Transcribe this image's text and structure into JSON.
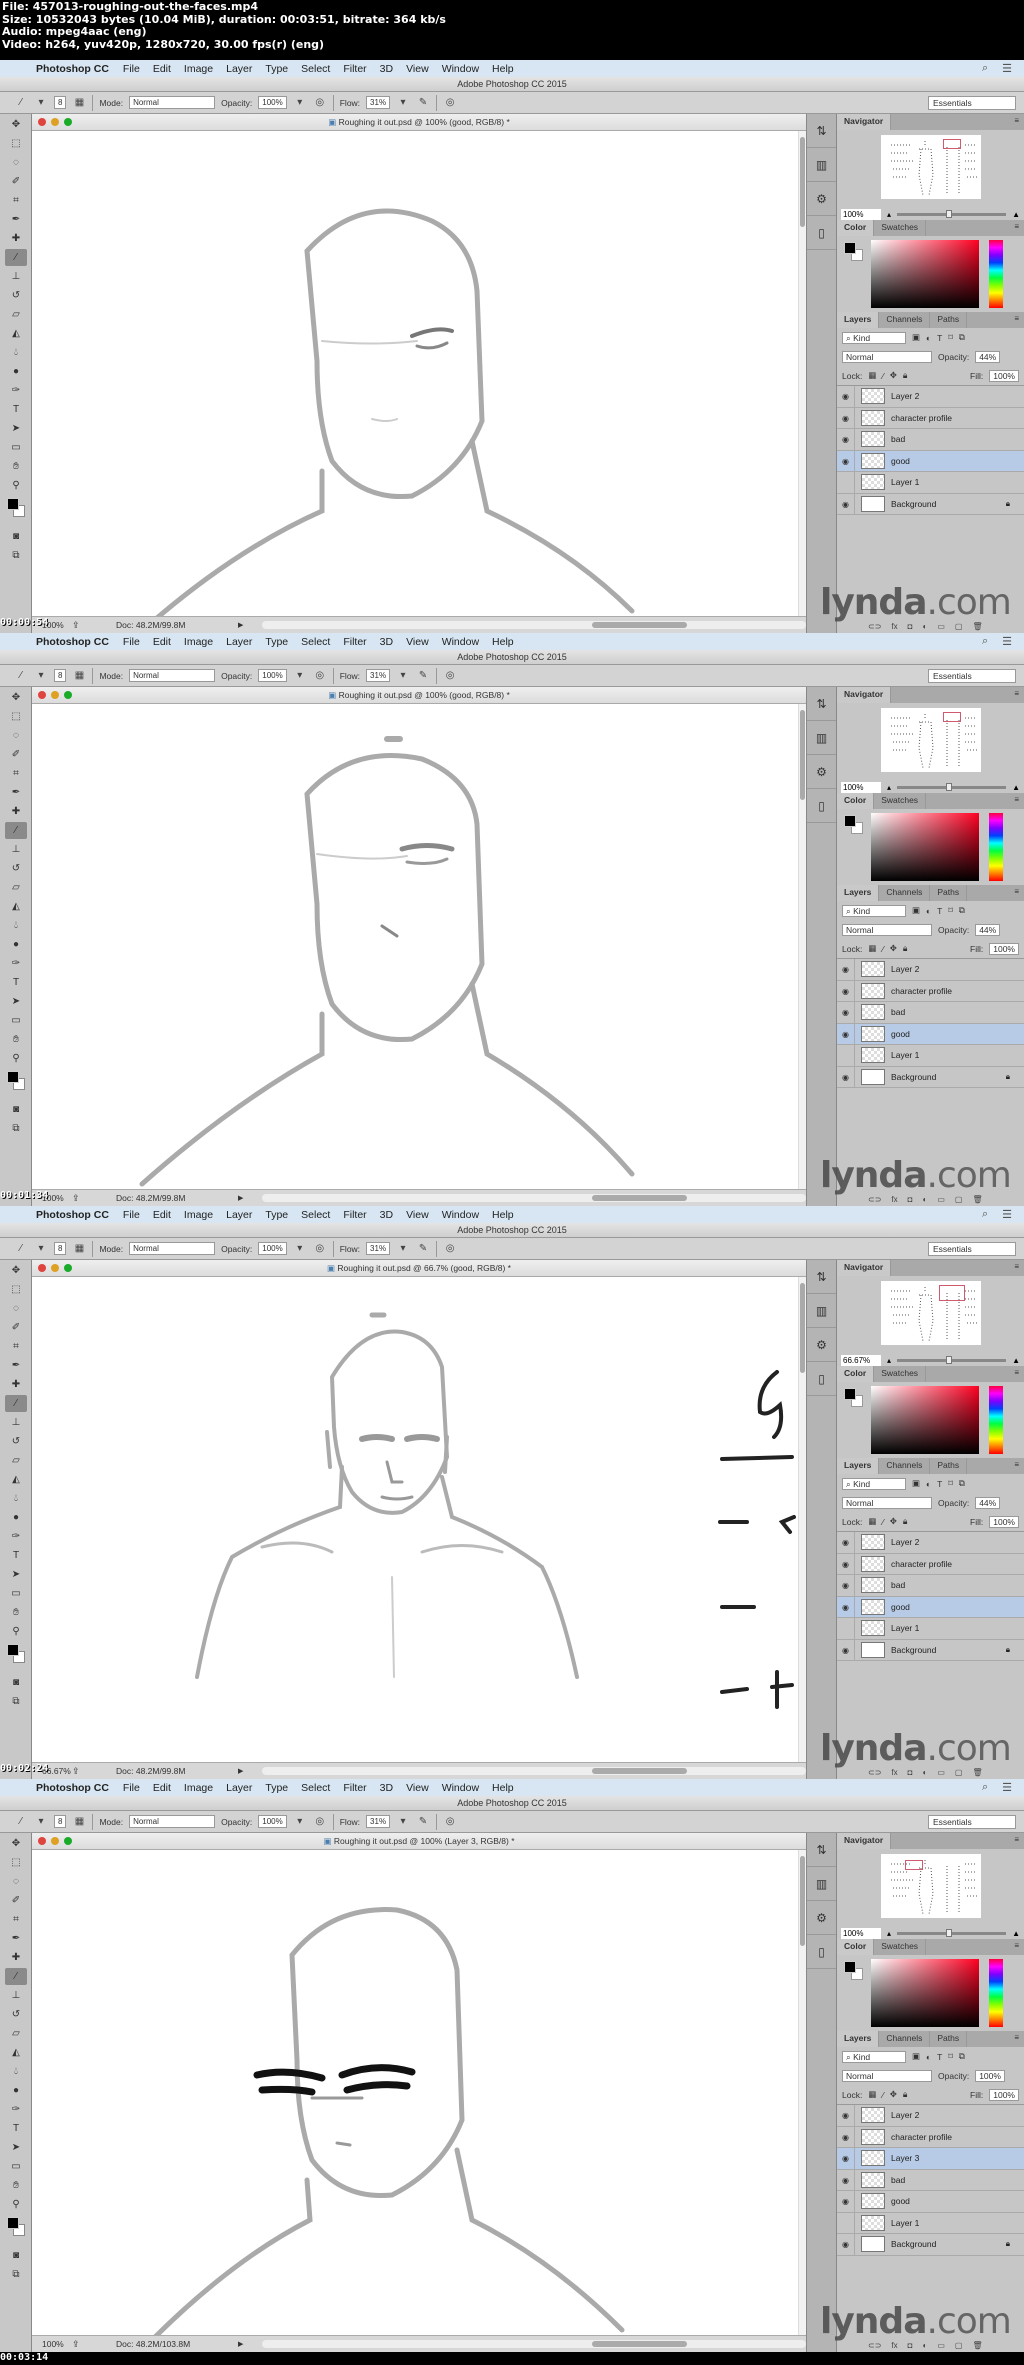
{
  "file_info": {
    "line1": "File: 457013-roughing-out-the-faces.mp4",
    "line2": "Size: 10532043 bytes (10.04 MiB), duration: 00:03:51, bitrate: 364 kb/s",
    "line3": "Audio: mpeg4aac (eng)",
    "line4": "Video: h264, yuv420p, 1280x720, 30.00 fps(r) (eng)"
  },
  "menubar": {
    "app": "Photoshop CC",
    "items": [
      "File",
      "Edit",
      "Image",
      "Layer",
      "Type",
      "Select",
      "Filter",
      "3D",
      "View",
      "Window",
      "Help"
    ]
  },
  "window_title": "Adobe Photoshop CC 2015",
  "options": {
    "brush_size": "8",
    "mode_label": "Mode:",
    "mode_value": "Normal",
    "opacity_label": "Opacity:",
    "opacity_value": "100%",
    "flow_label": "Flow:",
    "flow_value": "31%",
    "workspace": "Essentials"
  },
  "panels": {
    "navigator_tab": "Navigator",
    "color_tab": "Color",
    "swatches_tab": "Swatches",
    "layers_tab": "Layers",
    "channels_tab": "Channels",
    "paths_tab": "Paths",
    "kind_label": "Kind",
    "lock_label": "Lock:",
    "fill_label": "Fill:",
    "fill_value": "100%",
    "blend_mode": "Normal",
    "opacity_label": "Opacity:"
  },
  "brand": {
    "lynda": "lynda",
    "com": ".com"
  },
  "frames": [
    {
      "timestamp": "00:00:54",
      "doc_title": "Roughing it out.psd @ 100% (good, RGB/8) *",
      "zoom": "100%",
      "nav_zoom": "100%",
      "doc_size": "Doc: 48.2M/99.8M",
      "layer_opacity": "44%",
      "layers": [
        {
          "name": "Layer 2",
          "visible": true,
          "active": false
        },
        {
          "name": "character profile",
          "visible": true,
          "active": false
        },
        {
          "name": "bad",
          "visible": true,
          "active": false
        },
        {
          "name": "good",
          "visible": true,
          "active": true
        },
        {
          "name": "Layer 1",
          "visible": false,
          "active": false
        },
        {
          "name": "Background",
          "visible": true,
          "active": false,
          "locked": true
        }
      ]
    },
    {
      "timestamp": "00:01:34",
      "doc_title": "Roughing it out.psd @ 100% (good, RGB/8) *",
      "zoom": "100%",
      "nav_zoom": "100%",
      "doc_size": "Doc: 48.2M/99.8M",
      "layer_opacity": "44%",
      "layers": [
        {
          "name": "Layer 2",
          "visible": true,
          "active": false
        },
        {
          "name": "character profile",
          "visible": true,
          "active": false
        },
        {
          "name": "bad",
          "visible": true,
          "active": false
        },
        {
          "name": "good",
          "visible": true,
          "active": true
        },
        {
          "name": "Layer 1",
          "visible": false,
          "active": false
        },
        {
          "name": "Background",
          "visible": true,
          "active": false,
          "locked": true
        }
      ]
    },
    {
      "timestamp": "00:02:24",
      "doc_title": "Roughing it out.psd @ 66.7% (good, RGB/8) *",
      "zoom": "66.67%",
      "nav_zoom": "66.67%",
      "doc_size": "Doc: 48.2M/99.8M",
      "layer_opacity": "44%",
      "layers": [
        {
          "name": "Layer 2",
          "visible": true,
          "active": false
        },
        {
          "name": "character profile",
          "visible": true,
          "active": false
        },
        {
          "name": "bad",
          "visible": true,
          "active": false
        },
        {
          "name": "good",
          "visible": true,
          "active": true
        },
        {
          "name": "Layer 1",
          "visible": false,
          "active": false
        },
        {
          "name": "Background",
          "visible": true,
          "active": false,
          "locked": true
        }
      ]
    },
    {
      "timestamp": "00:03:14",
      "doc_title": "Roughing it out.psd @ 100% (Layer 3, RGB/8) *",
      "zoom": "100%",
      "nav_zoom": "100%",
      "doc_size": "Doc: 48.2M/103.8M",
      "layer_opacity": "100%",
      "layers": [
        {
          "name": "Layer 2",
          "visible": true,
          "active": false
        },
        {
          "name": "character profile",
          "visible": true,
          "active": false
        },
        {
          "name": "Layer 3",
          "visible": true,
          "active": true
        },
        {
          "name": "bad",
          "visible": true,
          "active": false
        },
        {
          "name": "good",
          "visible": true,
          "active": false
        },
        {
          "name": "Layer 1",
          "visible": false,
          "active": false
        },
        {
          "name": "Background",
          "visible": true,
          "active": false,
          "locked": true
        }
      ]
    }
  ]
}
